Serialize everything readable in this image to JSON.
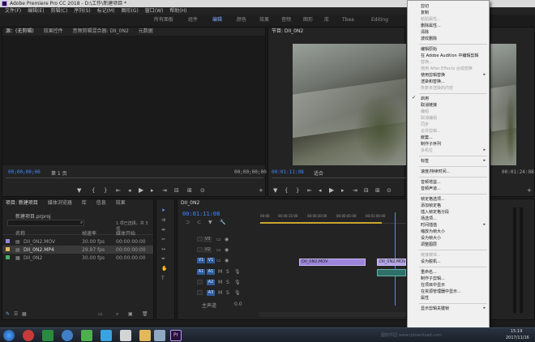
{
  "window": {
    "title": "Adobe Premiere Pro CC 2018 - D:\\工作\\新建项目 *"
  },
  "menubar": [
    "文件(F)",
    "编辑(E)",
    "剪辑(C)",
    "序列(S)",
    "标记(M)",
    "图形(G)",
    "窗口(W)",
    "帮助(H)"
  ],
  "workspaces": [
    "所有面板",
    "组件",
    "编辑",
    "颜色",
    "效果",
    "音频",
    "图形",
    "库",
    "Tbea",
    "Editing"
  ],
  "source": {
    "tabs": [
      "源：(无剪辑)",
      "效果控件",
      "音频剪辑混合器: DII_0N2",
      "元数据"
    ],
    "timecode_left": "00;00;00;00",
    "page": "第 1 页",
    "timecode_right": "00;00;00;00"
  },
  "program": {
    "title": "节目: DII_0N2",
    "timecode_left": "00:01:11:08",
    "fit": "适合",
    "fraction": "1/2",
    "timecode_right": "00:01:24:08"
  },
  "project": {
    "tabs": [
      "项目: 新建项目",
      "媒体浏览器",
      "库",
      "信息",
      "效果"
    ],
    "bin": "新建项目.prproj",
    "items_count": "1 项已选择，共 3 项",
    "columns": [
      "名称",
      "帧速率",
      "媒体开始",
      "媒体结束"
    ],
    "rows": [
      {
        "name": "DII_0N2.MOV",
        "fps": "30.00 fps",
        "start": "00:00:00:00",
        "color": "#9c84d8"
      },
      {
        "name": "DII_0N2.MP4",
        "fps": "29.97 fps",
        "start": "00:00:00:00",
        "color": "#e5b95a"
      },
      {
        "name": "DII_0N2",
        "fps": "30.00 fps",
        "start": "00:00:00:00",
        "color": "#48b06b"
      }
    ]
  },
  "timeline": {
    "tab": "DII_0N2",
    "timecode": "00:01:11:08",
    "ruler": [
      "00:00",
      "00:00:15:00",
      "00:00:30:00",
      "00:00:45:00",
      "00:01:00:00",
      "00:01:15:00"
    ],
    "video_tracks": [
      "V3",
      "V2",
      "V1"
    ],
    "audio_tracks": [
      "A1",
      "A2",
      "A3"
    ],
    "master": "主声道",
    "master_value": "0.0",
    "clip1": "DII_0N2.MOV",
    "clip2": "DII_0N2.MOV"
  },
  "context_menu": {
    "items": [
      {
        "label": "剪切",
        "enabled": true
      },
      {
        "label": "复制",
        "enabled": true
      },
      {
        "label": "粘贴属性...",
        "enabled": false
      },
      {
        "label": "删除属性...",
        "enabled": true
      },
      {
        "label": "清除",
        "enabled": true
      },
      {
        "label": "波纹删除",
        "enabled": true
      },
      {
        "sep": true
      },
      {
        "label": "编辑原始",
        "enabled": true
      },
      {
        "label": "在 Adobe Audition 中编辑剪辑",
        "enabled": true
      },
      {
        "label": "替换...",
        "enabled": false
      },
      {
        "label": "使用 After Effects 合成替换",
        "enabled": false
      },
      {
        "label": "使用剪辑替换",
        "enabled": true,
        "submenu": true
      },
      {
        "label": "渲染和替换...",
        "enabled": true
      },
      {
        "label": "恢复未渲染的内容",
        "enabled": false
      },
      {
        "sep": true
      },
      {
        "label": "启用",
        "enabled": true,
        "checked": true
      },
      {
        "label": "取消链接",
        "enabled": true
      },
      {
        "label": "编组",
        "enabled": false
      },
      {
        "label": "取消编组",
        "enabled": false
      },
      {
        "label": "同步",
        "enabled": false
      },
      {
        "label": "合并剪辑...",
        "enabled": false
      },
      {
        "label": "嵌套...",
        "enabled": true
      },
      {
        "label": "制作子序列",
        "enabled": true
      },
      {
        "label": "多机位",
        "enabled": false,
        "submenu": true
      },
      {
        "sep": true
      },
      {
        "label": "标签",
        "enabled": true,
        "submenu": true
      },
      {
        "sep": true
      },
      {
        "label": "速度/持续时间...",
        "enabled": true
      },
      {
        "sep": true
      },
      {
        "label": "音频增益...",
        "enabled": true
      },
      {
        "label": "音频声道...",
        "enabled": true
      },
      {
        "sep": true
      },
      {
        "label": "帧定格选项...",
        "enabled": true
      },
      {
        "label": "添加帧定格",
        "enabled": true
      },
      {
        "label": "插入帧定格分段",
        "enabled": true
      },
      {
        "label": "场选项...",
        "enabled": true
      },
      {
        "label": "时间插值",
        "enabled": true,
        "submenu": true
      },
      {
        "label": "缩放为帧大小",
        "enabled": true
      },
      {
        "label": "设为帧大小",
        "enabled": true
      },
      {
        "label": "调整图层",
        "enabled": true
      },
      {
        "sep": true
      },
      {
        "label": "链接媒体...",
        "enabled": false
      },
      {
        "label": "设为脱机...",
        "enabled": true
      },
      {
        "sep": true
      },
      {
        "label": "重命名...",
        "enabled": true
      },
      {
        "label": "制作子剪辑...",
        "enabled": true
      },
      {
        "label": "在项目中显示",
        "enabled": true
      },
      {
        "label": "在资源管理器中显示...",
        "enabled": true
      },
      {
        "label": "属性",
        "enabled": true
      },
      {
        "sep": true
      },
      {
        "label": "显示剪辑关键帧",
        "enabled": true,
        "submenu": true
      }
    ]
  },
  "taskbar": {
    "time": "15:19",
    "date": "2017/11/16",
    "watermark": "图软件园 www.rjdownload.com"
  }
}
